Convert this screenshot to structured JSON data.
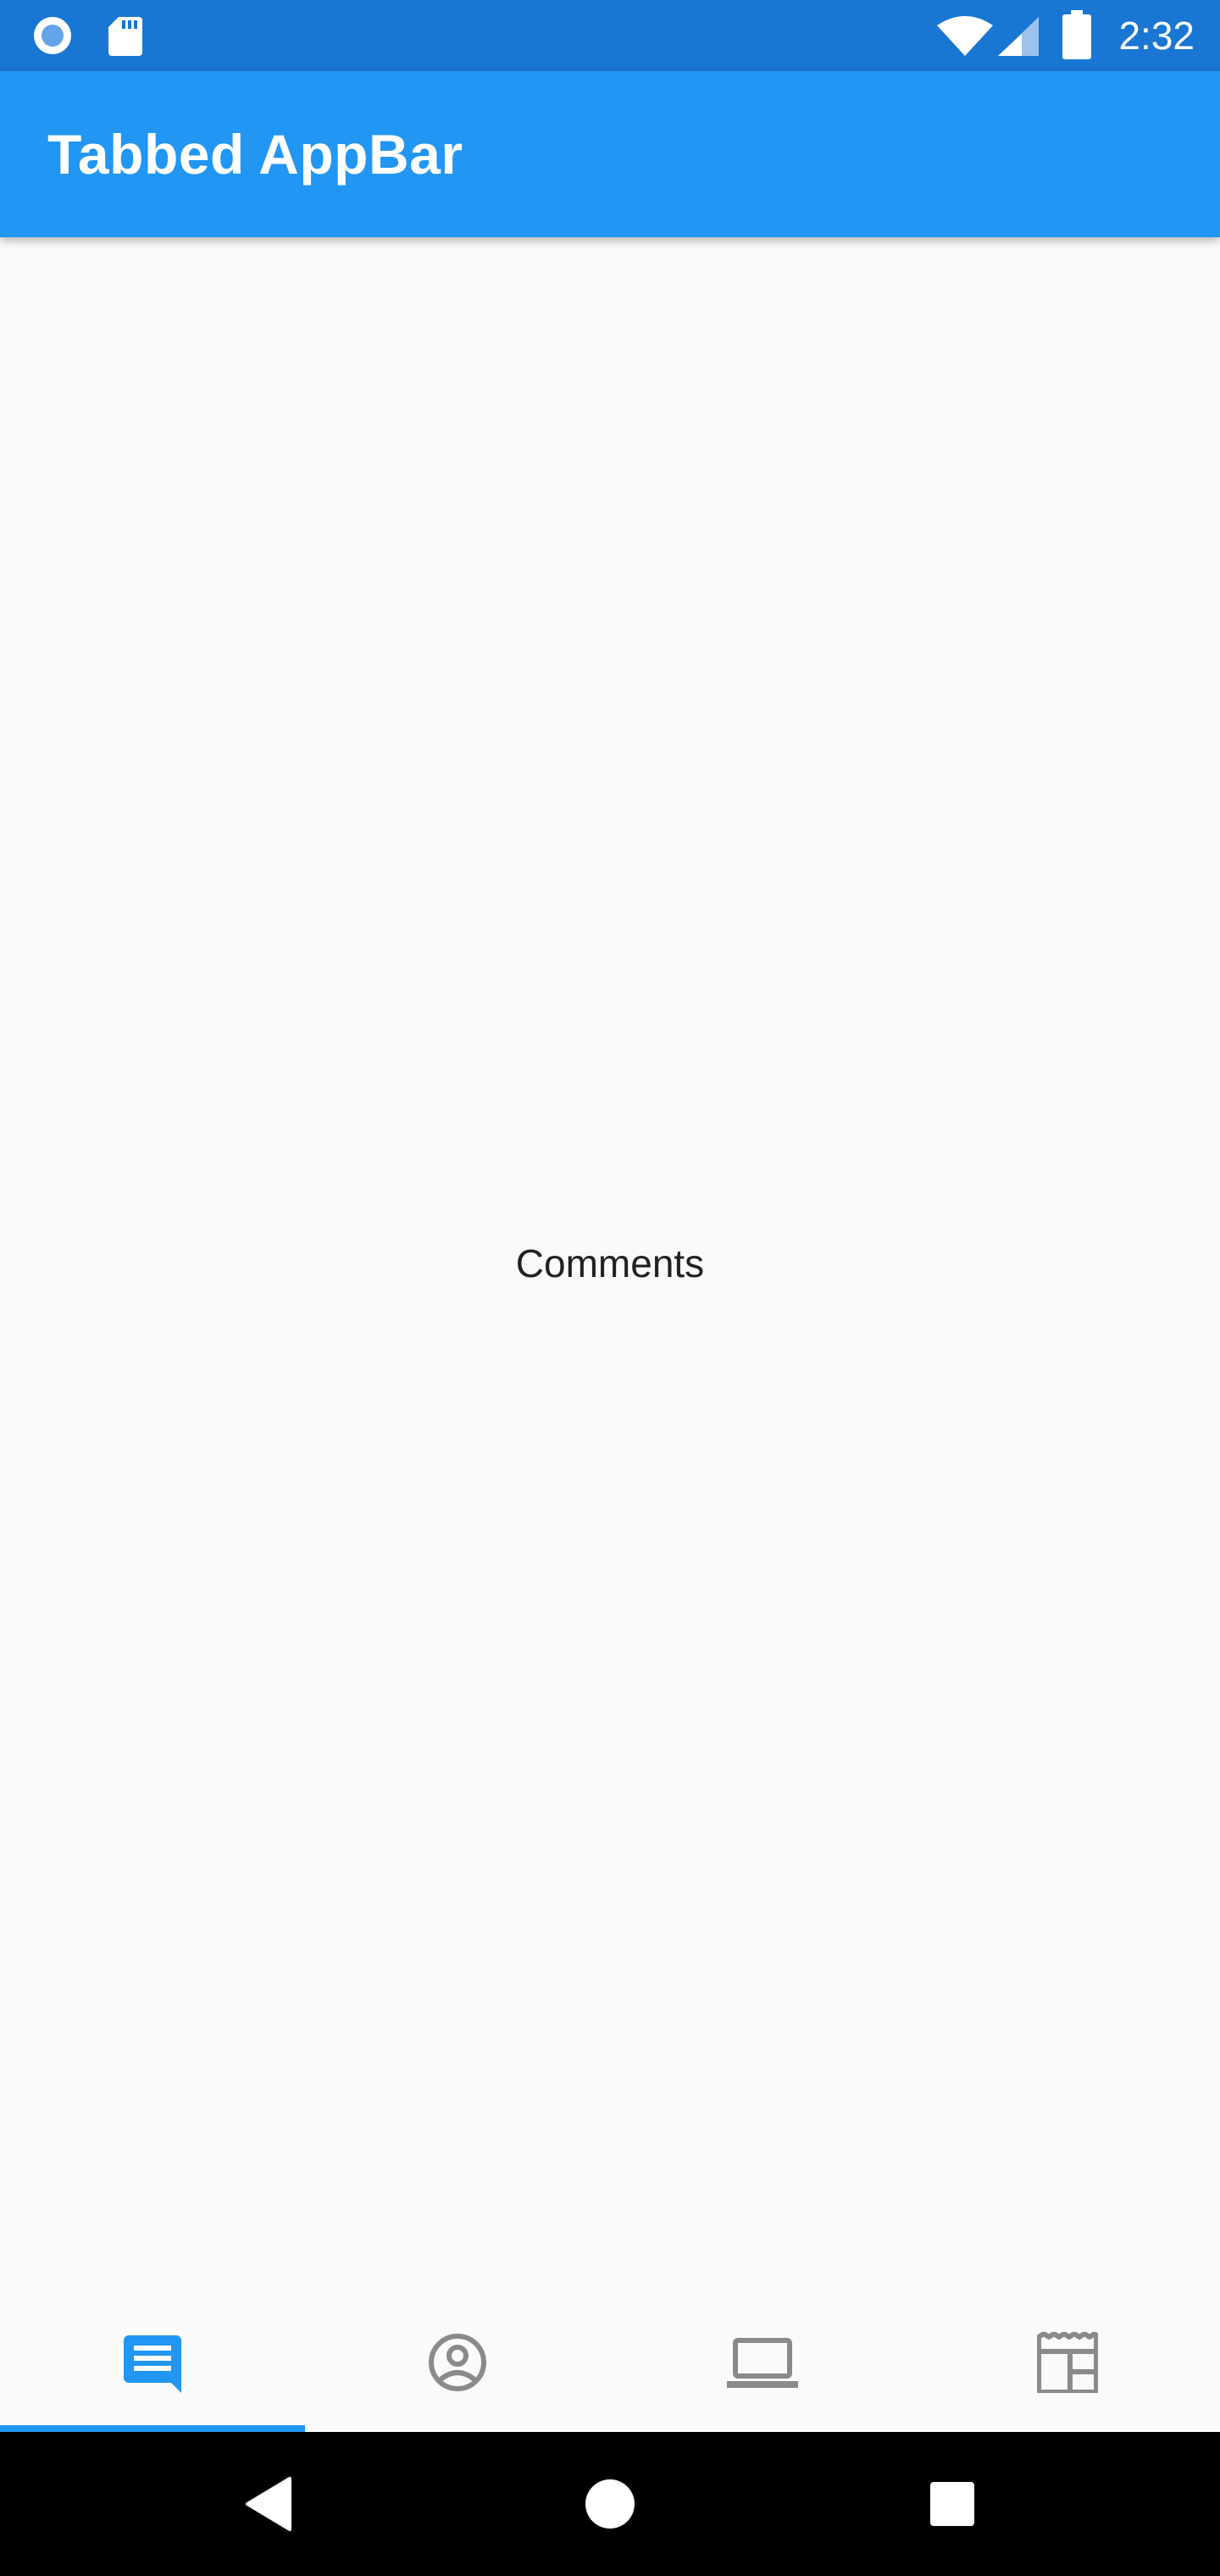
{
  "status_bar": {
    "time": "2:32",
    "icons": [
      "record-icon",
      "sd-card-icon",
      "wifi-icon",
      "signal-icon",
      "battery-icon"
    ]
  },
  "app_bar": {
    "title": "Tabbed AppBar",
    "color": "#2196F3"
  },
  "body": {
    "text": "Comments"
  },
  "tabs": [
    {
      "icon": "comment-icon",
      "selected": true
    },
    {
      "icon": "account-circle-icon",
      "selected": false
    },
    {
      "icon": "laptop-icon",
      "selected": false
    },
    {
      "icon": "newspaper-icon",
      "selected": false
    }
  ],
  "colors": {
    "status_bar": "#1976D2",
    "accent": "#2196F3",
    "tab_inactive": "#8A8A8A",
    "background": "#FAFAFA",
    "nav_bar": "#000000"
  },
  "nav_bar": {
    "buttons": [
      "back-icon",
      "home-icon",
      "recents-icon"
    ]
  }
}
